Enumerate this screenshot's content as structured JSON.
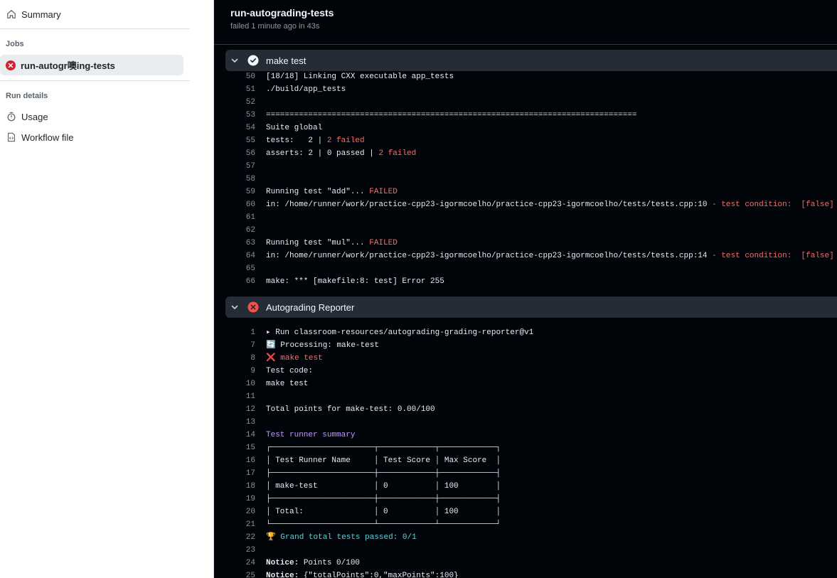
{
  "sidebar": {
    "summary_label": "Summary",
    "jobs_heading": "Jobs",
    "active_job": "run-autogr噢ing-tests",
    "run_details_heading": "Run details",
    "usage_label": "Usage",
    "workflow_label": "Workflow file"
  },
  "header": {
    "title": "run-autograding-tests",
    "subtitle": "failed 1 minute ago in 43s"
  },
  "steps": [
    {
      "name": "make test",
      "status": "success"
    },
    {
      "name": "Autograding Reporter",
      "status": "failure"
    }
  ],
  "log1": [
    {
      "n": "50",
      "t": "[18/18] Linking CXX executable app_tests"
    },
    {
      "n": "51",
      "t": "./build/app_tests"
    },
    {
      "n": "52",
      "t": ""
    },
    {
      "n": "53",
      "t": "==============================================================================="
    },
    {
      "n": "54",
      "t": "Suite global"
    },
    {
      "n": "55",
      "a": "tests:   2 | ",
      "b": "2 failed"
    },
    {
      "n": "56",
      "a": "asserts: 2 | 0 passed | ",
      "b": "2 failed"
    },
    {
      "n": "57",
      "t": ""
    },
    {
      "n": "58",
      "t": ""
    },
    {
      "n": "59",
      "a": "Running test \"add\"... ",
      "b": "FAILED"
    },
    {
      "n": "60",
      "a": "in: /home/runner/work/practice-cpp23-igormcoelho/practice-cpp23-igormcoelho/tests/tests.cpp:10 ",
      "b": "- test condition:  [false]"
    },
    {
      "n": "61",
      "t": ""
    },
    {
      "n": "62",
      "t": ""
    },
    {
      "n": "63",
      "a": "Running test \"mul\"... ",
      "b": "FAILED"
    },
    {
      "n": "64",
      "a": "in: /home/runner/work/practice-cpp23-igormcoelho/practice-cpp23-igormcoelho/tests/tests.cpp:14 ",
      "b": "- test condition:  [false]"
    },
    {
      "n": "65",
      "t": ""
    },
    {
      "n": "66",
      "t": "make: *** [makefile:8: test] Error 255"
    }
  ],
  "log2": [
    {
      "n": "1",
      "t": "▸ Run classroom-resources/autograding-grading-reporter@v1"
    },
    {
      "n": "7",
      "t": "🔄 Processing: make-test"
    },
    {
      "n": "8",
      "t": "❌ make test",
      "cls": "red"
    },
    {
      "n": "9",
      "t": "Test code:"
    },
    {
      "n": "10",
      "t": "make test"
    },
    {
      "n": "11",
      "t": ""
    },
    {
      "n": "12",
      "t": "Total points for make-test: 0.00/100"
    },
    {
      "n": "13",
      "t": ""
    },
    {
      "n": "14",
      "t": "Test runner summary",
      "cls": "purple"
    },
    {
      "n": "15",
      "t": "┌──────────────────────┬────────────┬────────────┐"
    },
    {
      "n": "16",
      "t": "│ Test Runner Name     │ Test Score │ Max Score  │"
    },
    {
      "n": "17",
      "t": "├──────────────────────┼────────────┼────────────┤"
    },
    {
      "n": "18",
      "t": "│ make-test            │ 0          │ 100        │"
    },
    {
      "n": "19",
      "t": "├──────────────────────┼────────────┼────────────┤"
    },
    {
      "n": "20",
      "t": "│ Total:               │ 0          │ 100        │"
    },
    {
      "n": "21",
      "t": "└──────────────────────┴────────────┴────────────┘"
    },
    {
      "n": "22",
      "t": "🏆 Grand total tests passed: 0/1",
      "cls": "cyan"
    },
    {
      "n": "23",
      "t": ""
    },
    {
      "n": "24",
      "a": "Notice:",
      "c": " Points 0/100"
    },
    {
      "n": "25",
      "a": "Notice:",
      "c": " {\"totalPoints\":0,\"maxPoints\":100}"
    }
  ]
}
